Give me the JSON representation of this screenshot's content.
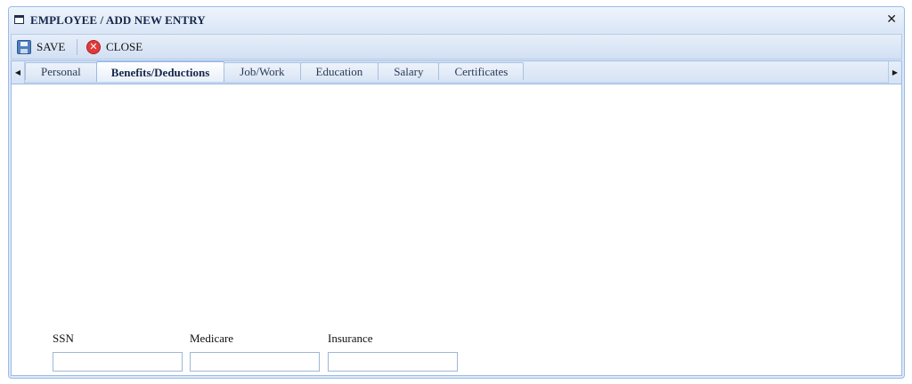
{
  "window": {
    "title": "EMPLOYEE / ADD NEW ENTRY",
    "close_glyph": "✕"
  },
  "toolbar": {
    "save_label": "SAVE",
    "close_label": "CLOSE",
    "close_glyph": "✕"
  },
  "tabs": {
    "scroll_left_glyph": "◀",
    "scroll_right_glyph": "▶",
    "items": [
      {
        "label": "Personal",
        "active": false
      },
      {
        "label": "Benefits/Deductions",
        "active": true
      },
      {
        "label": "Job/Work",
        "active": false
      },
      {
        "label": "Education",
        "active": false
      },
      {
        "label": "Salary",
        "active": false
      },
      {
        "label": "Certificates",
        "active": false
      }
    ]
  },
  "form": {
    "ssn": {
      "label": "SSN",
      "value": "",
      "placeholder": ""
    },
    "medicare": {
      "label": "Medicare",
      "value": "",
      "placeholder": ""
    },
    "insurance": {
      "label": "Insurance",
      "value": "",
      "placeholder": ""
    }
  },
  "icons": {
    "window": "window-icon",
    "save": "save-icon",
    "close": "close-circle-icon"
  },
  "colors": {
    "frame": "#dfe8f6",
    "border": "#99bbe8",
    "close_red": "#e03a3a",
    "save_blue": "#4f7fbc"
  }
}
